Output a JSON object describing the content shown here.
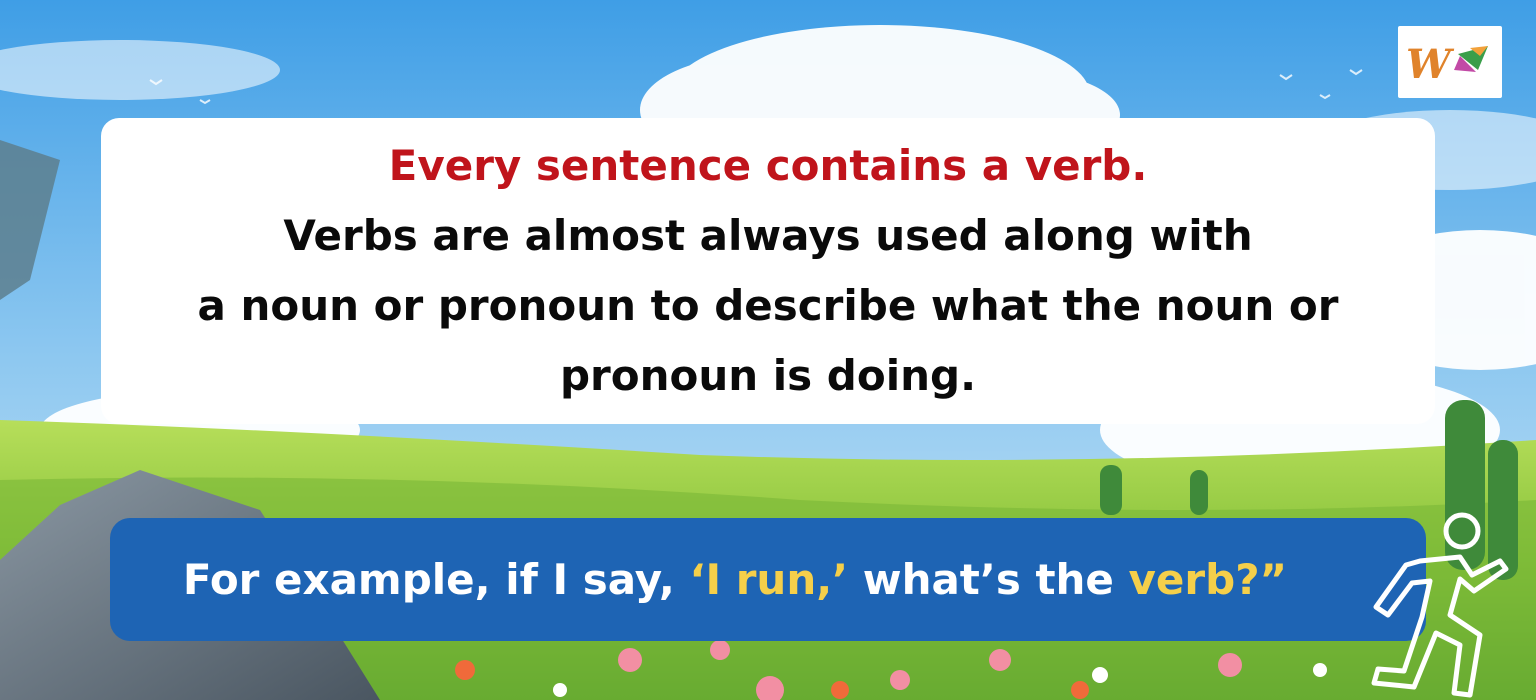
{
  "headline": "Every sentence contains a verb.",
  "body_lines": [
    "Verbs are almost always used along with",
    "a noun or pronoun to describe what the noun or",
    "pronoun is doing."
  ],
  "example": {
    "prefix": "For example, if I say, ",
    "quote": "‘I run,’",
    "middle": " what’s the ",
    "keyword": "verb?”"
  },
  "logo": {
    "letter": "W"
  },
  "icons": {
    "runner": "running-person-icon"
  },
  "colors": {
    "headline": "#c0141b",
    "banner": "#1e64b4",
    "highlight": "#f5cf4a"
  }
}
